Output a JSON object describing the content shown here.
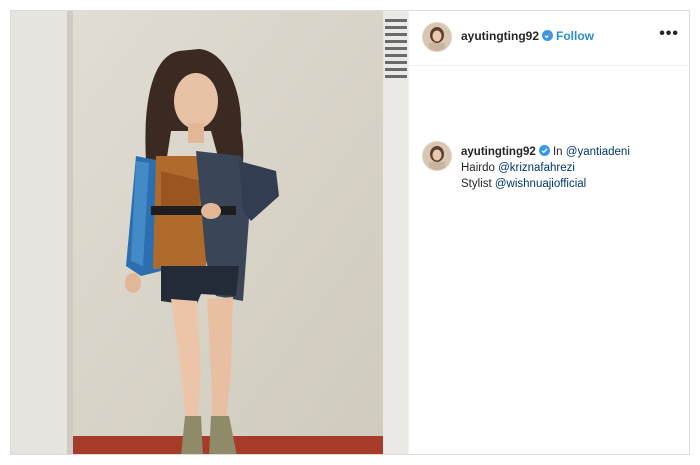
{
  "header": {
    "username": "ayutingting92",
    "separator": "•",
    "follow_label": "Follow",
    "more_label": "•••",
    "icons": {
      "avatar": "avatar",
      "verified": "verified-badge-icon",
      "more": "more-options-icon"
    }
  },
  "caption": {
    "username": "ayutingting92",
    "line1_prefix": "In ",
    "line1_mention": "@yantiadeni",
    "line2_prefix": "Hairdo ",
    "line2_mention": "@kriznafahrezi",
    "line3_prefix": "Stylist ",
    "line3_mention": "@wishnuajiofficial"
  },
  "colors": {
    "follow": "#2a8fd4",
    "mention": "#00376b",
    "verified": "#3897f0",
    "border": "#dbdbdb"
  }
}
